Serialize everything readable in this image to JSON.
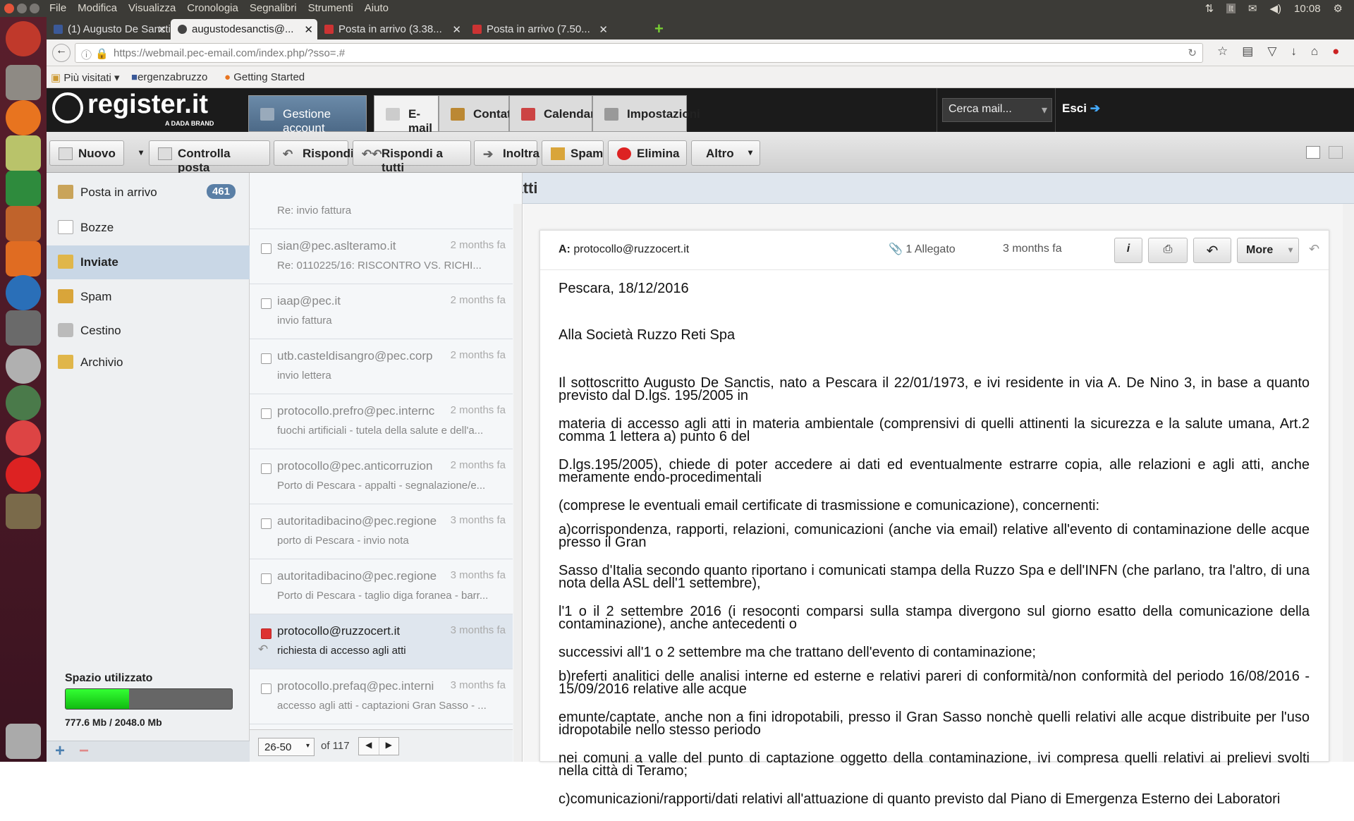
{
  "os": {
    "menu": [
      "File",
      "Modifica",
      "Visualizza",
      "Cronologia",
      "Segnalibri",
      "Strumenti",
      "Aiuto"
    ],
    "lang": "It",
    "clock": "10:08"
  },
  "tabs": [
    {
      "label": "(1) Augusto De Sanctis"
    },
    {
      "label": "augustodesanctis@..."
    },
    {
      "label": "Posta in arrivo (3.38..."
    },
    {
      "label": "Posta in arrivo (7.50..."
    }
  ],
  "address": "https://webmail.pec-email.com/index.php/?sso=.#",
  "bookmarks": [
    "Più visitati",
    "ergenzabruzzo",
    "Getting Started"
  ],
  "app": {
    "logo": "register.it",
    "logo_sub": "A DADA BRAND",
    "nav": [
      "Gestione account",
      "E-mail",
      "Contatti",
      "Calendario",
      "Impostazioni"
    ],
    "search_placeholder": "Cerca mail...",
    "logout": "Esci"
  },
  "toolbar": [
    "Nuovo",
    "Controlla posta",
    "Rispondi",
    "Rispondi a tutti",
    "Inoltra",
    "Spam",
    "Elimina",
    "Altro"
  ],
  "folders": [
    {
      "label": "Posta in arrivo",
      "count": "461"
    },
    {
      "label": "Bozze"
    },
    {
      "label": "Inviate"
    },
    {
      "label": "Spam"
    },
    {
      "label": "Cestino"
    },
    {
      "label": "Archivio"
    }
  ],
  "quota": {
    "title": "Spazio utilizzato",
    "text": "777.6 Mb / 2048.0 Mb",
    "fraction": 0.38
  },
  "list_title": "Inviate - richiesta di accesso agli atti",
  "messages": [
    {
      "from": "",
      "date": "",
      "subject": "Re: invio fattura"
    },
    {
      "from": "sian@pec.aslteramo.it",
      "date": "2 months fa",
      "subject": "Re: 0110225/16: RISCONTRO VS. RICHI..."
    },
    {
      "from": "iaap@pec.it",
      "date": "2 months fa",
      "subject": "invio fattura"
    },
    {
      "from": "utb.casteldisangro@pec.corp",
      "date": "2 months fa",
      "subject": "invio lettera"
    },
    {
      "from": "protocollo.prefro@pec.internc",
      "date": "2 months fa",
      "subject": "fuochi artificiali - tutela della salute e dell'a..."
    },
    {
      "from": "protocollo@pec.anticorruzion",
      "date": "2 months fa",
      "subject": "Porto di Pescara - appalti - segnalazione/e..."
    },
    {
      "from": "autoritadibacino@pec.regione",
      "date": "3 months fa",
      "subject": "porto di Pescara - invio nota"
    },
    {
      "from": "autoritadibacino@pec.regione",
      "date": "3 months fa",
      "subject": "Porto di Pescara - taglio diga foranea - barr..."
    },
    {
      "from": "protocollo@ruzzocert.it",
      "date": "3 months fa",
      "subject": "richiesta di accesso agli atti"
    },
    {
      "from": "protocollo.prefaq@pec.interni",
      "date": "3 months fa",
      "subject": "accesso agli atti - captazioni Gran Sasso - ..."
    }
  ],
  "pager": {
    "range": "26-50",
    "of": "of 117"
  },
  "message": {
    "to_label": "A:",
    "to": "protocollo@ruzzocert.it",
    "attach": "1 Allegato",
    "date": "3 months fa",
    "more": "More",
    "paragraphs": [
      "Pescara, 18/12/2016",
      "Alla Società Ruzzo Reti Spa",
      "Il sottoscritto Augusto De Sanctis, nato a Pescara il 22/01/1973, e ivi residente in via A. De Nino 3, in base a quanto previsto dal D.lgs. 195/2005 in",
      "materia di accesso agli atti in materia ambientale (comprensivi di quelli attinenti la sicurezza e la salute umana, Art.2 comma 1 lettera a) punto 6 del",
      "D.lgs.195/2005), chiede  di poter accedere ai dati ed eventualmente estrarre copia, alle relazioni e agli atti, anche meramente endo-procedimentali",
      "(comprese le eventuali email certificate di trasmissione e comunicazione), concernenti:",
      "a)corrispondenza, rapporti, relazioni, comunicazioni (anche via email) relative all'evento di contaminazione delle acque presso il Gran",
      "Sasso d'Italia secondo quanto riportano i comunicati stampa della Ruzzo Spa e dell'INFN (che parlano, tra l'altro, di una nota della ASL dell'1 settembre),",
      "l'1 o il 2 settembre 2016 (i resoconti comparsi sulla stampa divergono sul giorno esatto della comunicazione della contaminazione), anche antecedenti o",
      "successivi all'1 o 2 settembre ma che trattano dell'evento di contaminazione;",
      "b)referti analitici delle analisi interne ed esterne e relativi pareri di conformità/non conformità del periodo 16/08/2016 - 15/09/2016 relative alle acque",
      "emunte/captate, anche non a fini idropotabili, presso il Gran Sasso nonchè quelli relativi alle acque distribuite per l'uso idropotabile nello stesso periodo",
      "nei comuni a valle del punto di captazione oggetto della contaminazione, ivi compresa quelli relativi ai prelievi svolti nella città di Teramo;",
      "c)comunicazioni/rapporti/dati relativi all'attuazione di quanto previsto dal Piano di Emergenza Esterno dei Laboratori"
    ]
  }
}
